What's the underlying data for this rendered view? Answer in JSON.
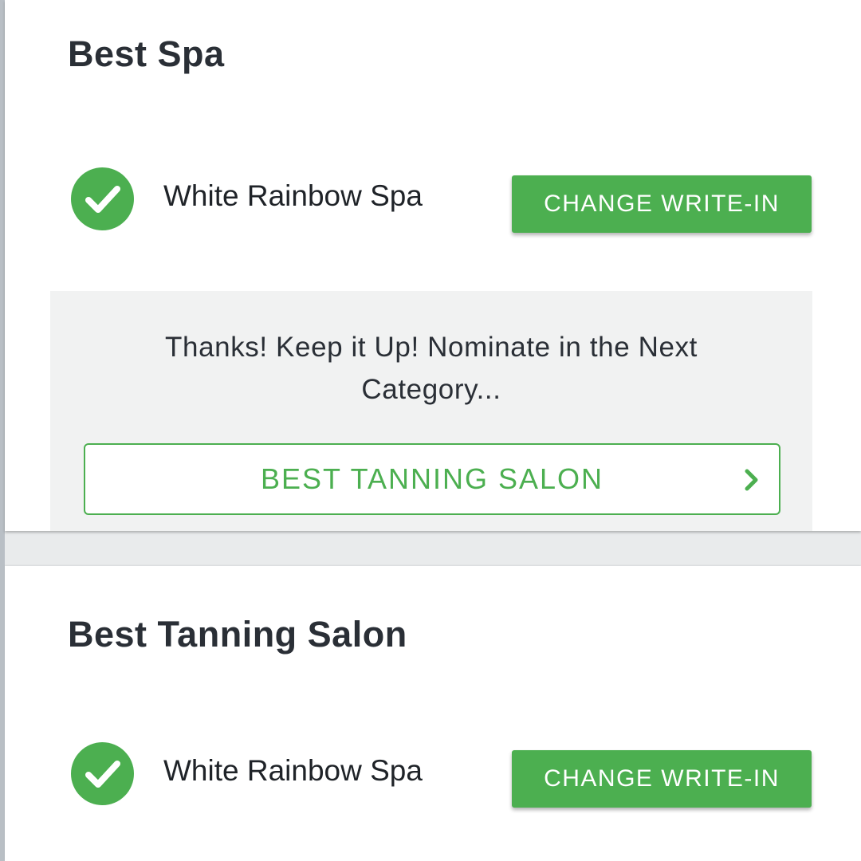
{
  "colors": {
    "accent": "#4caf50",
    "text": "#2a2f36",
    "panel": "#f1f2f2"
  },
  "categories": [
    {
      "title": "Best Spa",
      "choice": "White Rainbow Spa",
      "button_label": "CHANGE WRITE-IN",
      "status_icon": "checkmark-circle-icon"
    },
    {
      "title": "Best Tanning Salon",
      "choice": "White Rainbow Spa",
      "button_label": "CHANGE WRITE-IN",
      "status_icon": "checkmark-circle-icon"
    }
  ],
  "next_prompt": {
    "message": "Thanks! Keep it Up! Nominate in the Next Category...",
    "next_category_label": "BEST TANNING SALON",
    "arrow_icon": "chevron-right-icon"
  }
}
